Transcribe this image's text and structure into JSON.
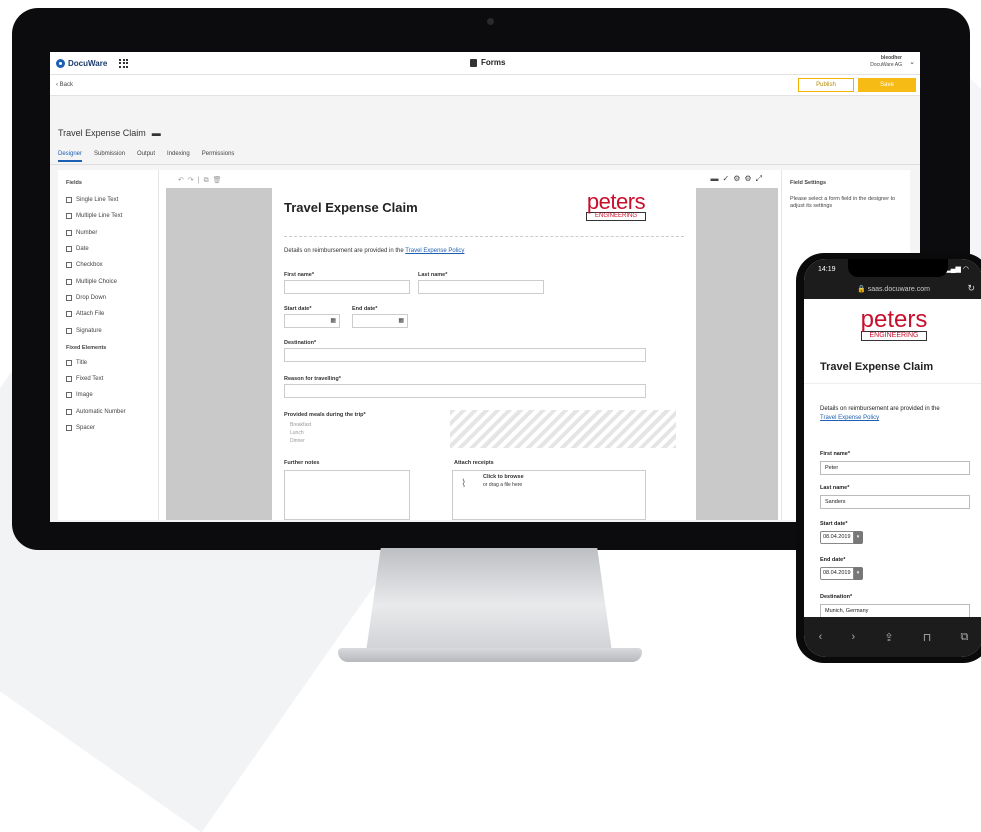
{
  "app": {
    "brand": "DocuWare",
    "title": "Forms",
    "user_name": "bleodher",
    "user_org": "DocuWare AG"
  },
  "subbar": {
    "back": "‹ Back",
    "publish": "Publish",
    "save": "Save"
  },
  "document": {
    "title": "Travel Expense Claim"
  },
  "tabs": [
    "Designer",
    "Submission",
    "Output",
    "Indexing",
    "Permissions"
  ],
  "fields_panel": {
    "heading": "Fields",
    "items": [
      "Single Line Text",
      "Multiple Line Text",
      "Number",
      "Date",
      "Checkbox",
      "Multiple Choice",
      "Drop Down",
      "Attach File",
      "Signature"
    ],
    "fixed_heading": "Fixed Elements",
    "fixed_items": [
      "Title",
      "Fixed Text",
      "Image",
      "Automatic Number",
      "Spacer"
    ]
  },
  "form": {
    "title": "Travel Expense Claim",
    "logo_top": "peters",
    "logo_bottom": "ENGINEERING",
    "intro": "Details on reimbursement are provided in the",
    "intro_link": "Travel Expense Policy",
    "first_name": "First name*",
    "last_name": "Last name*",
    "start_date": "Start date*",
    "end_date": "End date*",
    "destination": "Destination*",
    "reason": "Reason for travelling*",
    "meals": "Provided meals during the trip*",
    "meal_options": [
      "Breakfast",
      "Lunch",
      "Dinner"
    ],
    "notes": "Further notes",
    "receipts": "Attach receipts",
    "browse": "Click to browse",
    "drag": "or drag a file here"
  },
  "settings_panel": {
    "heading": "Field Settings",
    "text": "Please select a form field in the designer to adjust its settings"
  },
  "phone": {
    "time": "14:19",
    "url": "saas.docuware.com",
    "logo_top": "peters",
    "logo_bottom": "ENGINEERING",
    "title": "Travel Expense Claim",
    "intro": "Details on reimbursement are provided in the",
    "intro_link": "Travel Expense Policy",
    "first_name_label": "First name*",
    "first_name_value": "Peter",
    "last_name_label": "Last name*",
    "last_name_value": "Sanders",
    "start_date_label": "Start date*",
    "start_date_value": "08.04.2019",
    "end_date_label": "End date*",
    "end_date_value": "08.04.2019",
    "destination_label": "Destination*",
    "destination_value": "Munich, Germany"
  }
}
